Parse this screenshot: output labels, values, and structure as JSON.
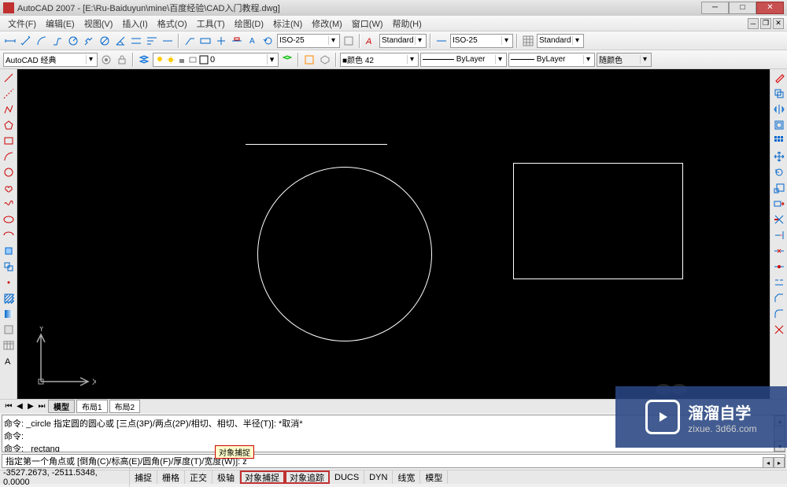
{
  "title": "AutoCAD 2007 - [E:\\Ru-Baiduyun\\mine\\百度经验\\CAD入门教程.dwg]",
  "menus": [
    "文件(F)",
    "编辑(E)",
    "视图(V)",
    "插入(I)",
    "格式(O)",
    "工具(T)",
    "绘图(D)",
    "标注(N)",
    "修改(M)",
    "窗口(W)",
    "帮助(H)"
  ],
  "dim_style1": "ISO-25",
  "dim_style2": "ISO-25",
  "text_style": "Standard",
  "workspace": "AutoCAD 经典",
  "layer_name": "0",
  "color_label": "■颜色 42",
  "linetype": "ByLayer",
  "lineweight": "ByLayer",
  "plot_style": "随颜色",
  "layout_tabs": {
    "model": "模型",
    "layout1": "布局1",
    "layout2": "布局2"
  },
  "command_history": {
    "line1": "命令: _circle 指定圆的圆心或 [三点(3P)/两点(2P)/相切、相切、半径(T)]: *取消*",
    "line2": "命令:",
    "line3": "命令: _rectang"
  },
  "command_input": "指定第一个角点或 [倒角(C)/标高(E)/圆角(F)/厚度(T)/宽度(W)]: z",
  "snap_tooltip": "对象捕捉",
  "coords": "-3527.2673, -2511.5348, 0.0000",
  "status_buttons": [
    "捕捉",
    "栅格",
    "正交",
    "极轴",
    "对象捕捉",
    "对象追踪",
    "DUCS",
    "DYN",
    "线宽",
    "模型"
  ],
  "axis": {
    "x": "X",
    "y": "Y"
  },
  "watermark": {
    "main": "溜溜自学",
    "sub": "zixue. 3d66.com"
  }
}
